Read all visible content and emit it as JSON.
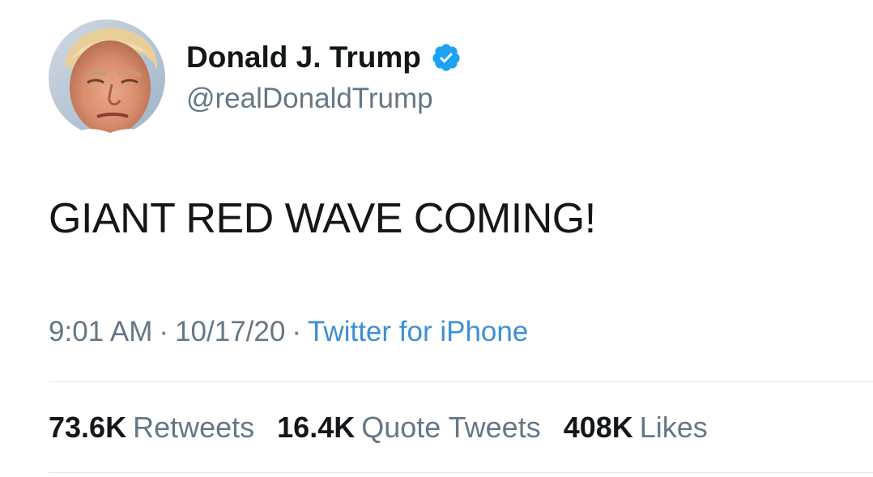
{
  "author": {
    "name": "Donald J. Trump",
    "handle": "@realDonaldTrump",
    "verified_icon": "verified-badge-icon"
  },
  "tweet": {
    "text": "GIANT RED WAVE COMING!",
    "time": "9:01 AM",
    "date": "10/17/20",
    "separator": "·",
    "source": "Twitter for iPhone"
  },
  "stats": {
    "retweets": {
      "count": "73.6K",
      "label": "Retweets"
    },
    "quotes": {
      "count": "16.4K",
      "label": "Quote Tweets"
    },
    "likes": {
      "count": "408K",
      "label": "Likes"
    }
  },
  "colors": {
    "text": "#14171a",
    "secondary": "#657786",
    "link": "#3d8fd6",
    "verified": "#1da1f2",
    "divider": "#e1e8ed"
  }
}
